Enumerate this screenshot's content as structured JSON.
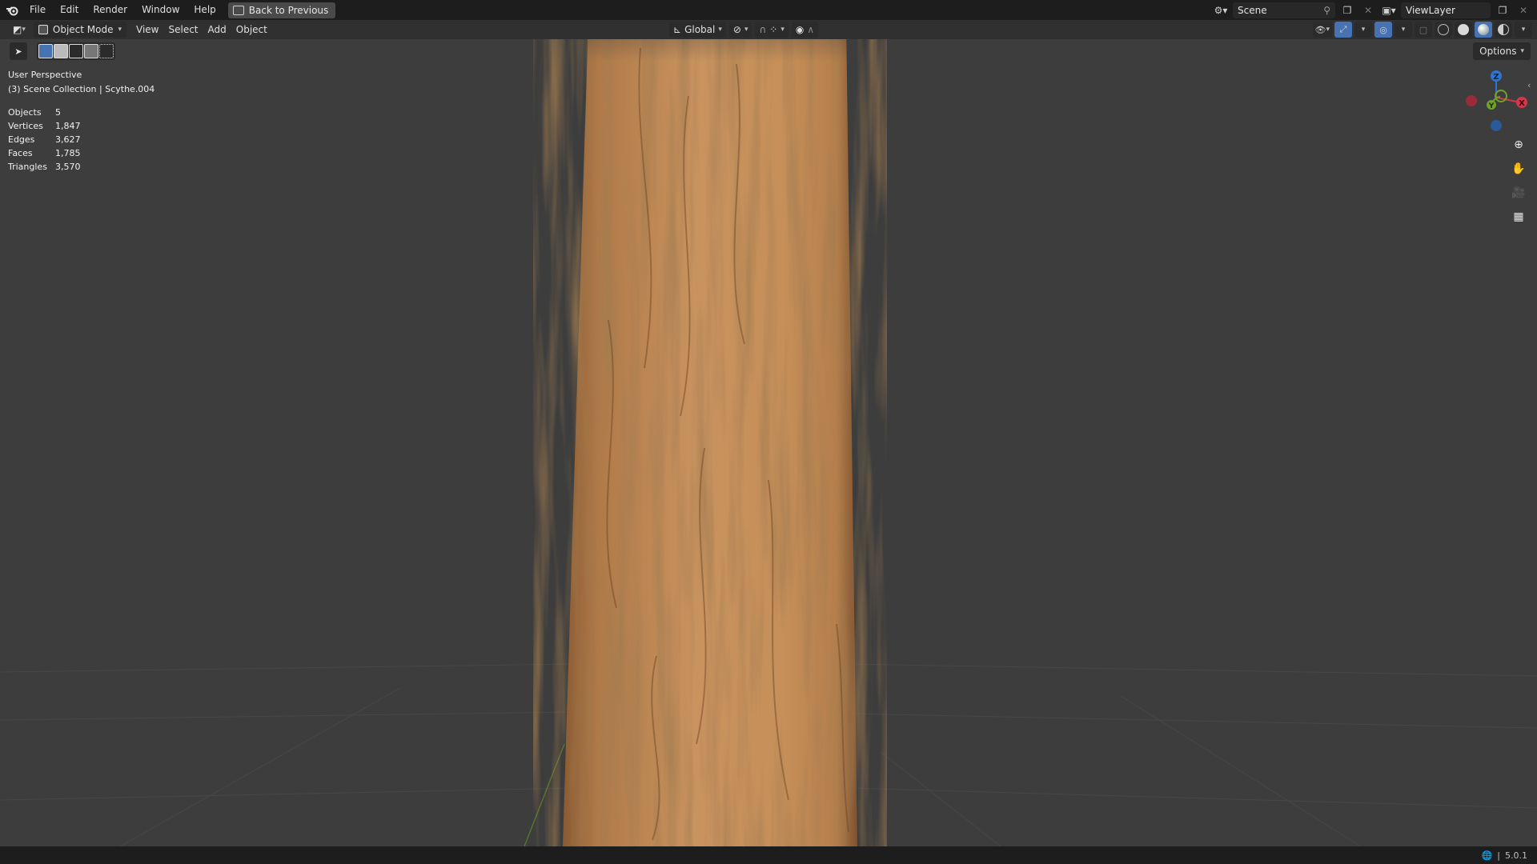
{
  "menubar": {
    "items": [
      "File",
      "Edit",
      "Render",
      "Window",
      "Help"
    ],
    "back_button": "Back to Previous",
    "scene": "Scene",
    "view_layer": "ViewLayer"
  },
  "header": {
    "mode": "Object Mode",
    "menus": [
      "View",
      "Select",
      "Add",
      "Object"
    ],
    "orientation": "Global",
    "options": "Options"
  },
  "viewport": {
    "perspective": "User Perspective",
    "collection": "(3) Scene Collection | Scythe.004",
    "stats": [
      {
        "label": "Objects",
        "value": "5"
      },
      {
        "label": "Vertices",
        "value": "1,847"
      },
      {
        "label": "Edges",
        "value": "3,627"
      },
      {
        "label": "Faces",
        "value": "1,785"
      },
      {
        "label": "Triangles",
        "value": "3,570"
      }
    ],
    "gizmo": {
      "z": "Z",
      "y": "Y",
      "x": "X"
    }
  },
  "statusbar": {
    "version": "5.0.1"
  },
  "colors": {
    "axis_x": "#d1394b",
    "axis_y": "#6ea22b",
    "axis_z": "#2f74d0",
    "accent": "#4772b3",
    "wood": "#c08a58"
  },
  "icons": [
    "blender-logo-icon",
    "back-icon",
    "scene-icon",
    "pin-icon",
    "view-layer-icon",
    "editor-type-icon",
    "transform-orientation-icon",
    "pivot-icon",
    "snap-icon",
    "proportional-edit-icon",
    "visibility-icon",
    "gizmo-icon",
    "overlay-icon",
    "xray-icon",
    "wireframe-shading-icon",
    "solid-shading-icon",
    "material-shading-icon",
    "rendered-shading-icon",
    "zoom-icon",
    "hand-pan-icon",
    "camera-icon",
    "grid-view-icon",
    "globe-icon"
  ]
}
